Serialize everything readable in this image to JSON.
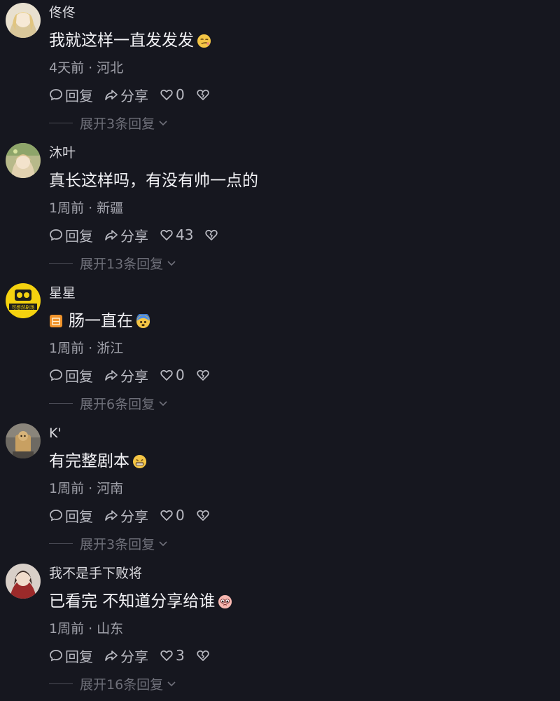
{
  "comments": [
    {
      "username": "佟佟",
      "content": "我就这样一直发发发",
      "emoji": "smirk-emoji",
      "time": "4天前",
      "location": "河北",
      "reply_label": "回复",
      "share_label": "分享",
      "likes": "0",
      "expand_text": "展开3条回复"
    },
    {
      "username": "沐叶",
      "content": "真长这样吗，有没有帅一点的",
      "emoji": "",
      "time": "1周前",
      "location": "新疆",
      "reply_label": "回复",
      "share_label": "分享",
      "likes": "43",
      "expand_text": "展开13条回复"
    },
    {
      "username": "星星",
      "content": "肠一直在",
      "badge": "orange-badge",
      "emoji": "scared-emoji",
      "time": "1周前",
      "location": "浙江",
      "reply_label": "回复",
      "share_label": "分享",
      "likes": "0",
      "expand_text": "展开6条回复",
      "avatar_text": "可想然剧场"
    },
    {
      "username": "K'",
      "content": "有完整剧本",
      "emoji": "grimace-emoji",
      "time": "1周前",
      "location": "河南",
      "reply_label": "回复",
      "share_label": "分享",
      "likes": "0",
      "expand_text": "展开3条回复"
    },
    {
      "username": "我不是手下败将",
      "content": "已看完 不知道分享给谁",
      "emoji": "pleading-emoji",
      "time": "1周前",
      "location": "山东",
      "reply_label": "回复",
      "share_label": "分享",
      "likes": "3",
      "expand_text": "展开16条回复"
    }
  ],
  "meta_separator": "·",
  "colors": {
    "background": "#16171f",
    "text": "#f2f2f5",
    "muted": "#a0a1aa",
    "expand": "#6f707a"
  }
}
